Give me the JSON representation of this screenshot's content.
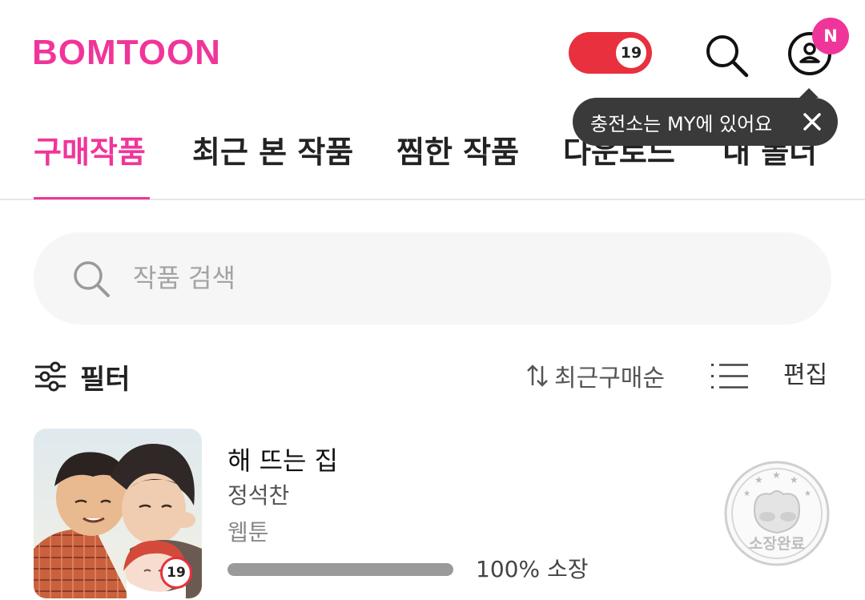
{
  "header": {
    "logo": "BOMTOON",
    "adult_badge": "19",
    "notification_badge": "N"
  },
  "tooltip": {
    "text": "충전소는 MY에 있어요"
  },
  "tabs": [
    {
      "label": "구매작품",
      "active": true
    },
    {
      "label": "최근 본 작품",
      "active": false
    },
    {
      "label": "찜한 작품",
      "active": false
    },
    {
      "label": "다운로드",
      "active": false
    },
    {
      "label": "내 폴더",
      "active": false
    }
  ],
  "search": {
    "placeholder": "작품 검색"
  },
  "toolbar": {
    "filter_label": "필터",
    "sort_label": "최근구매순",
    "edit_label": "편집"
  },
  "books": [
    {
      "title": "해 뜨는 집",
      "author": "정석찬",
      "genre": "웹툰",
      "age_rating": "19",
      "owned_progress": 100,
      "owned_text": "100% 소장",
      "stamp_text": "소장완료"
    }
  ],
  "colors": {
    "brand": "#f0359a",
    "adult": "#e8303f",
    "tooltip_bg": "#3a3a3a"
  }
}
